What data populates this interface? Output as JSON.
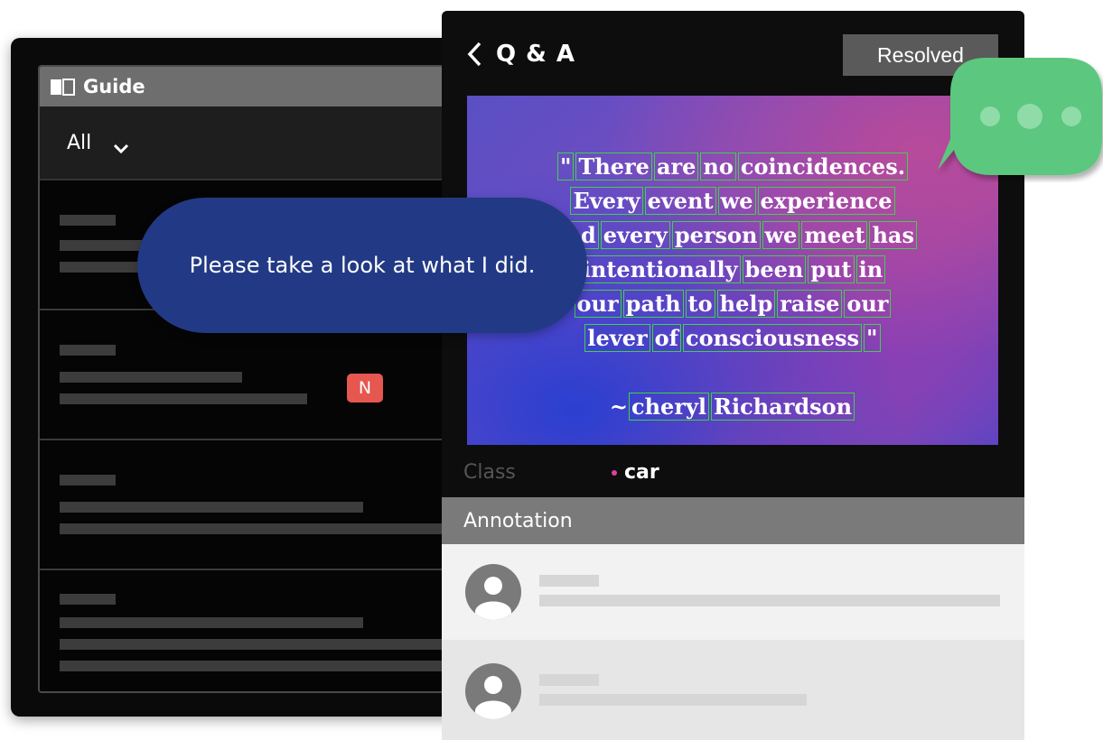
{
  "guide": {
    "title": "Guide",
    "filter_value": "All",
    "items": [
      {
        "has_badge": false
      },
      {
        "has_badge": true,
        "badge": "N"
      },
      {
        "has_badge": false
      },
      {
        "has_badge": false
      }
    ]
  },
  "bubble": {
    "message": "Please take a look at what I did."
  },
  "qa": {
    "title": "Q & A",
    "status_button": "Resolved",
    "image_quote": {
      "lines": [
        [
          "\"",
          "There",
          "are",
          "no",
          "coincidences."
        ],
        [
          "Every",
          "event",
          "we",
          "experience"
        ],
        [
          "and",
          "every",
          "person",
          "we",
          "meet",
          "has"
        ],
        [
          "intentionally",
          "been",
          "put",
          "in"
        ],
        [
          "our",
          "path",
          "to",
          "help",
          "raise",
          "our"
        ],
        [
          "lever",
          "of",
          "consciousness",
          "\""
        ]
      ],
      "author": [
        "~",
        "cheryl",
        "Richardson"
      ]
    },
    "class_label": "Class",
    "class_value": "car",
    "annotation_label": "Annotation"
  },
  "colors": {
    "bubble_blue": "#223a85",
    "bubble_green": "#5cc77e",
    "badge_red": "#e5574f",
    "box_green": "#3fd14a",
    "class_dot": "#e0409a"
  },
  "icons": {
    "guide": "book-icon",
    "filter": "chevron-down-icon",
    "back": "chevron-left-icon",
    "avatar": "user-avatar-icon",
    "chat": "chat-bubble-icon"
  }
}
